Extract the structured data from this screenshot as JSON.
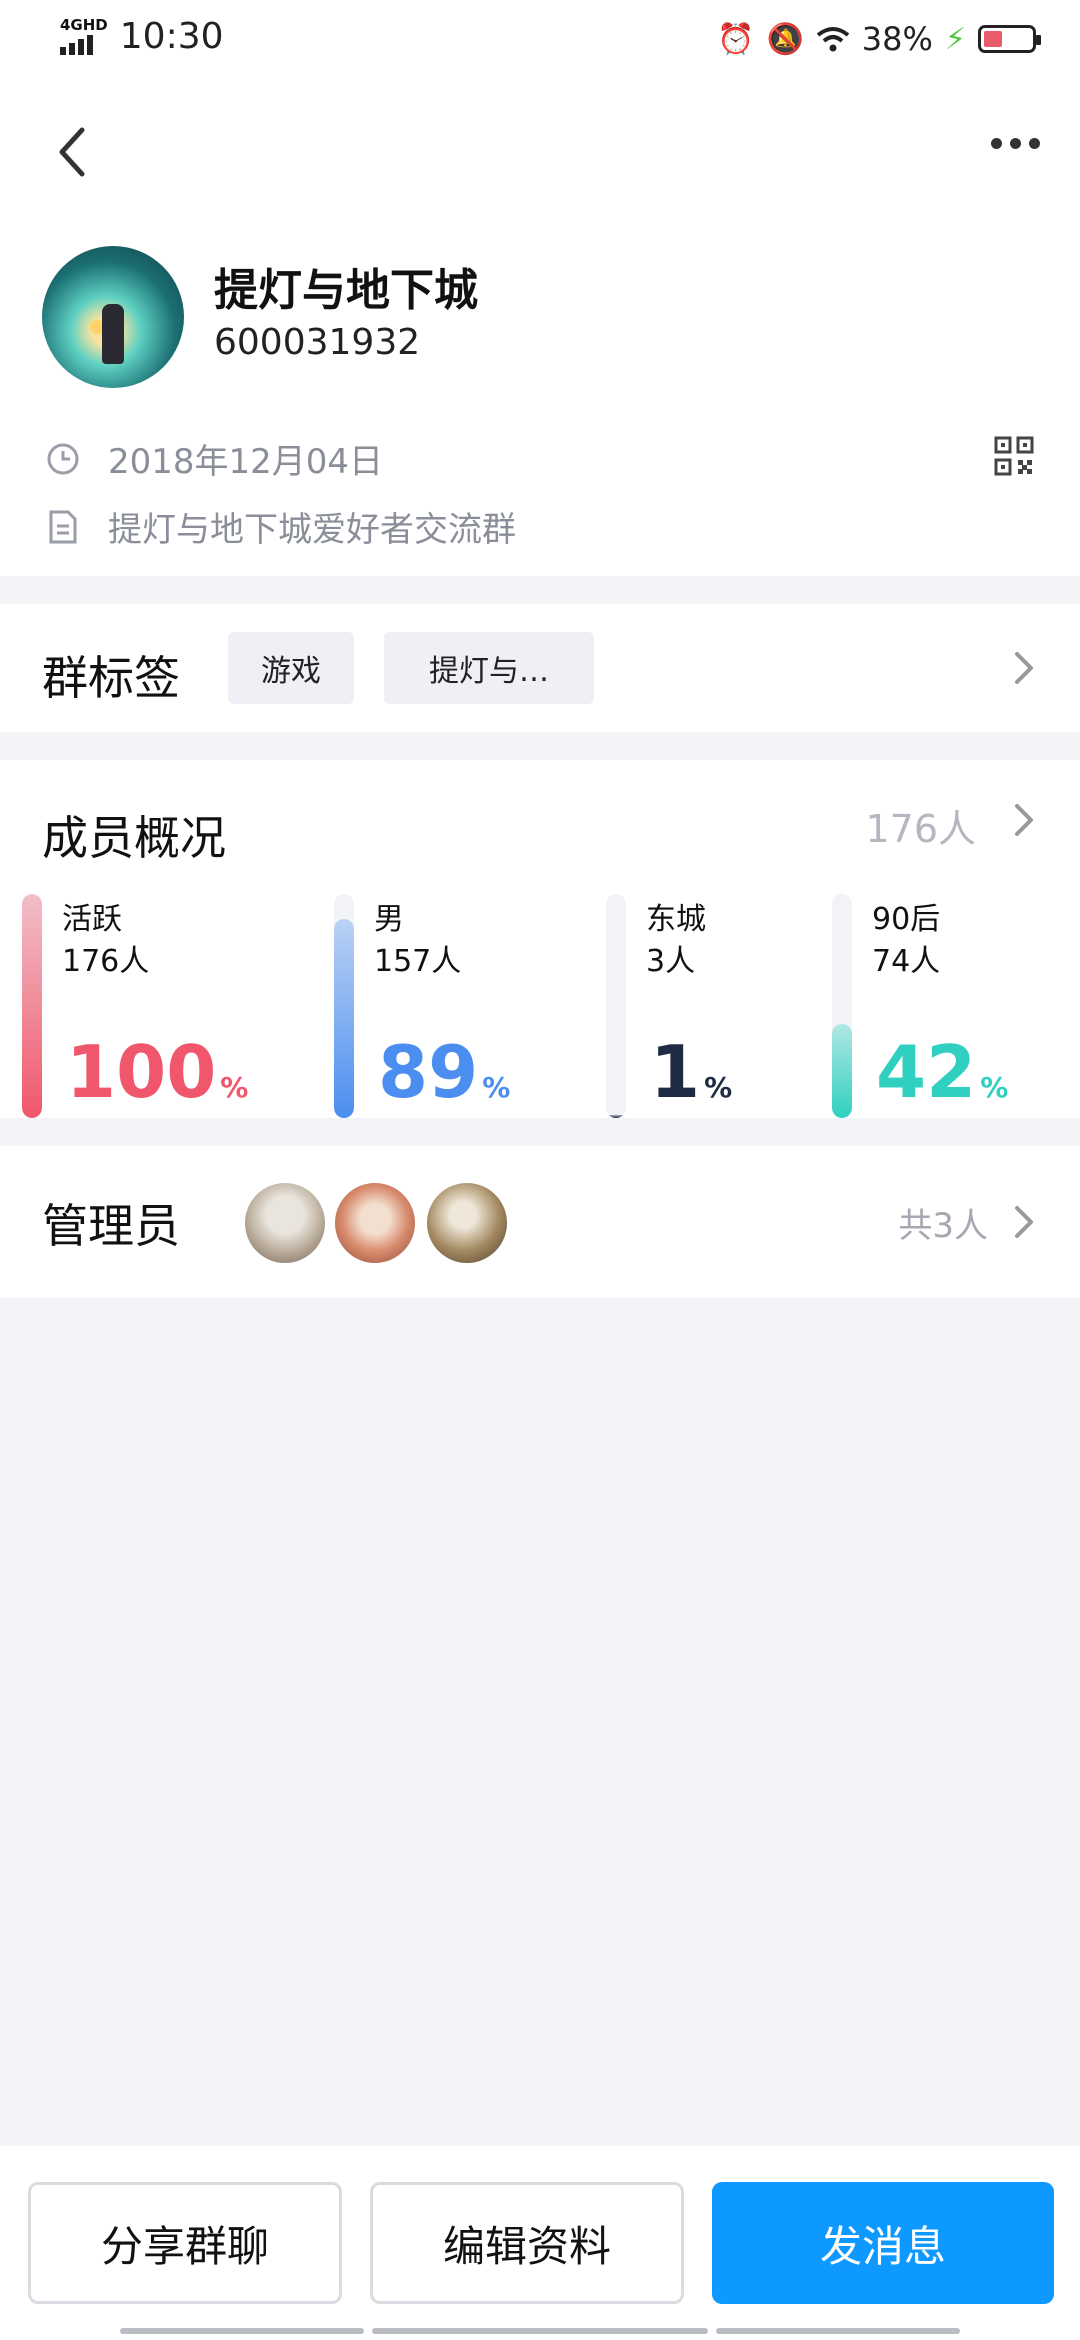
{
  "status_bar": {
    "network": "4GHD",
    "time": "10:30",
    "battery": "38%"
  },
  "group": {
    "name": "提灯与地下城",
    "id": "600031932",
    "created_date": "2018年12月04日",
    "description": "提灯与地下城爱好者交流群"
  },
  "tags_section": {
    "title": "群标签",
    "tags": [
      "游戏",
      "提灯与…"
    ]
  },
  "members_section": {
    "title": "成员概况",
    "count": "176人",
    "stats": [
      {
        "label": "活跃",
        "count": "176人",
        "percent": "100",
        "fraction": 1.0,
        "color": "#f0576c"
      },
      {
        "label": "男",
        "count": "157人",
        "percent": "89",
        "fraction": 0.89,
        "color": "#4b8ef0"
      },
      {
        "label": "东城",
        "count": "3人",
        "percent": "1",
        "fraction": 0.01,
        "color": "#1f2a44"
      },
      {
        "label": "90后",
        "count": "74人",
        "percent": "42",
        "fraction": 0.42,
        "color": "#2fd0c0"
      }
    ],
    "percent_unit": "%"
  },
  "admins_section": {
    "title": "管理员",
    "count": "共3人"
  },
  "actions": {
    "share": "分享群聊",
    "edit": "编辑资料",
    "send": "发消息"
  }
}
